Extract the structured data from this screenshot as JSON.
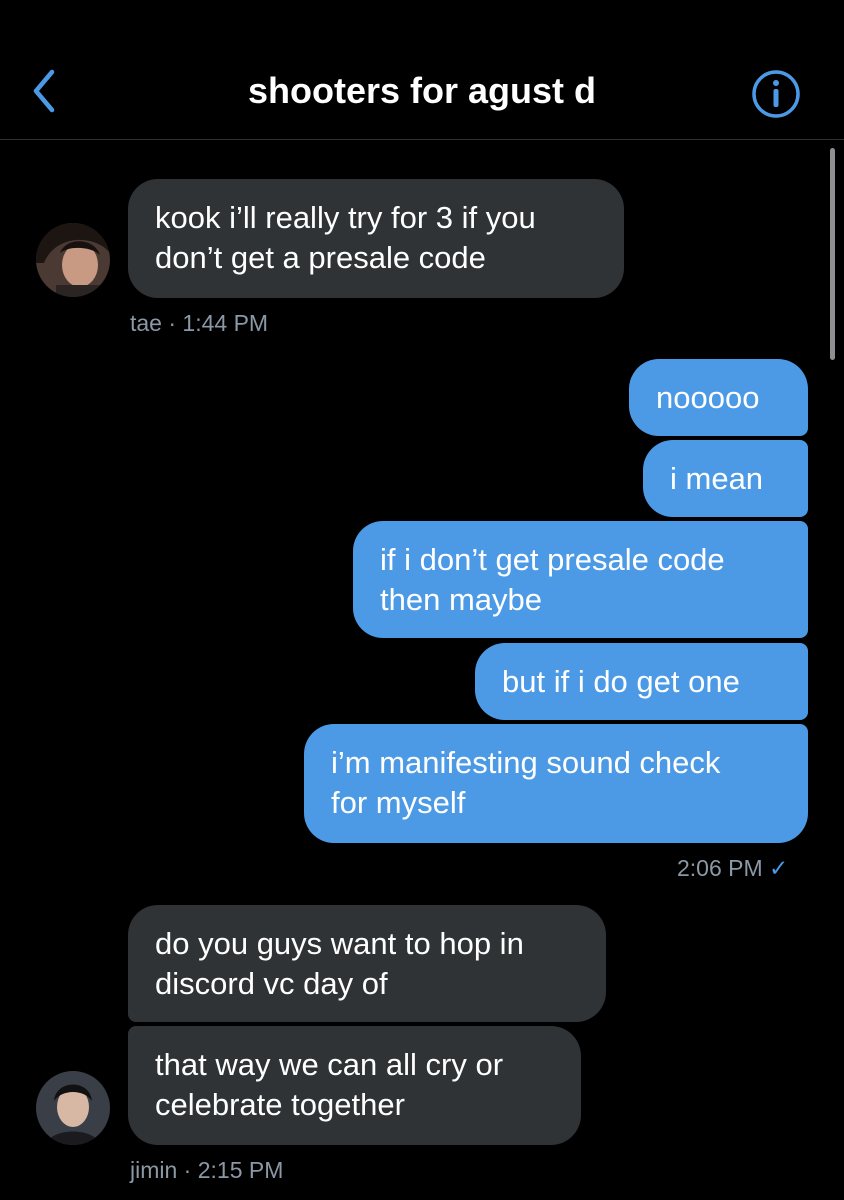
{
  "header": {
    "title": "shooters for agust d",
    "back_icon": "chevron-left-icon",
    "info_icon": "info-icon",
    "accent": "#4c9ae6"
  },
  "messages": [
    {
      "text": "kook i’ll really try for 3 if you\ndon’t get a presale code",
      "direction": "incoming"
    },
    {
      "text": "nooooo",
      "direction": "outgoing"
    },
    {
      "text": "i mean",
      "direction": "outgoing"
    },
    {
      "text": "if i don’t get presale code\nthen maybe",
      "direction": "outgoing"
    },
    {
      "text": "but if i do get one",
      "direction": "outgoing"
    },
    {
      "text": "i’m manifesting sound check\nfor myself",
      "direction": "outgoing"
    },
    {
      "text": "do you guys want to hop in\ndiscord vc day of",
      "direction": "incoming"
    },
    {
      "text": "that way we can all cry or\ncelebrate together",
      "direction": "incoming"
    }
  ],
  "meta": {
    "tae": "tae · 1:44 PM",
    "me": "2:06 PM",
    "me_check": "✓",
    "jimin": "jimin · 2:15 PM"
  },
  "colors": {
    "incoming_bubble": "#2f3336",
    "outgoing_bubble": "#4c9ae6",
    "meta_text": "#8b98a5"
  }
}
